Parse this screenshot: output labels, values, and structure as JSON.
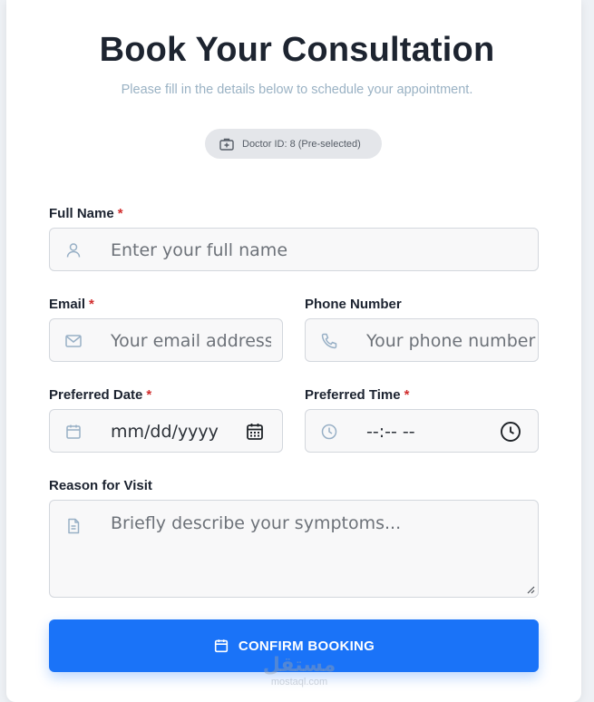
{
  "header": {
    "title": "Book Your Consultation",
    "subtitle": "Please fill in the details below to schedule your appointment."
  },
  "badge": {
    "icon": "medical-kit-icon",
    "text": "Doctor ID: 8 (Pre-selected)"
  },
  "form": {
    "full_name": {
      "label": "Full Name",
      "required_mark": "*",
      "icon": "user-icon",
      "placeholder": "Enter your full name"
    },
    "email": {
      "label": "Email",
      "required_mark": "*",
      "icon": "mail-icon",
      "placeholder": "Your email address"
    },
    "phone": {
      "label": "Phone Number",
      "icon": "phone-icon",
      "placeholder": "Your phone number"
    },
    "date": {
      "label": "Preferred Date",
      "required_mark": "*",
      "icon": "calendar-icon",
      "value": "mm/dd/yyyy",
      "picker_icon": "calendar-picker-icon"
    },
    "time": {
      "label": "Preferred Time",
      "required_mark": "*",
      "icon": "clock-icon",
      "value": "--:-- --",
      "picker_icon": "clock-picker-icon"
    },
    "reason": {
      "label": "Reason for Visit",
      "icon": "document-icon",
      "placeholder": "Briefly describe your symptoms..."
    }
  },
  "submit": {
    "icon": "calendar-icon",
    "label": "CONFIRM BOOKING"
  },
  "watermark": {
    "arabic": "مستقل",
    "latin": "mostaql.com"
  },
  "colors": {
    "accent": "#1a73f8",
    "required": "#d12d2d",
    "subtitle": "#9ab2c4"
  }
}
